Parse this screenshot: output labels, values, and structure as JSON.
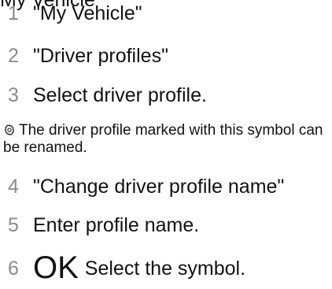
{
  "top_clip": "My Vehicle",
  "steps": [
    {
      "number": "1",
      "text": "\"My Vehicle\""
    },
    {
      "number": "2",
      "text": "\"Driver profiles\""
    },
    {
      "number": "3",
      "text": "Select driver profile."
    },
    {
      "number": "4",
      "text": "\"Change driver profile name\""
    },
    {
      "number": "5",
      "text": "Enter profile name."
    },
    {
      "number": "6",
      "text": "Select the symbol.",
      "symbol": "OK"
    }
  ],
  "note": {
    "text": "The driver profile marked with this symbol can be renamed.",
    "icon": "gear-icon"
  }
}
